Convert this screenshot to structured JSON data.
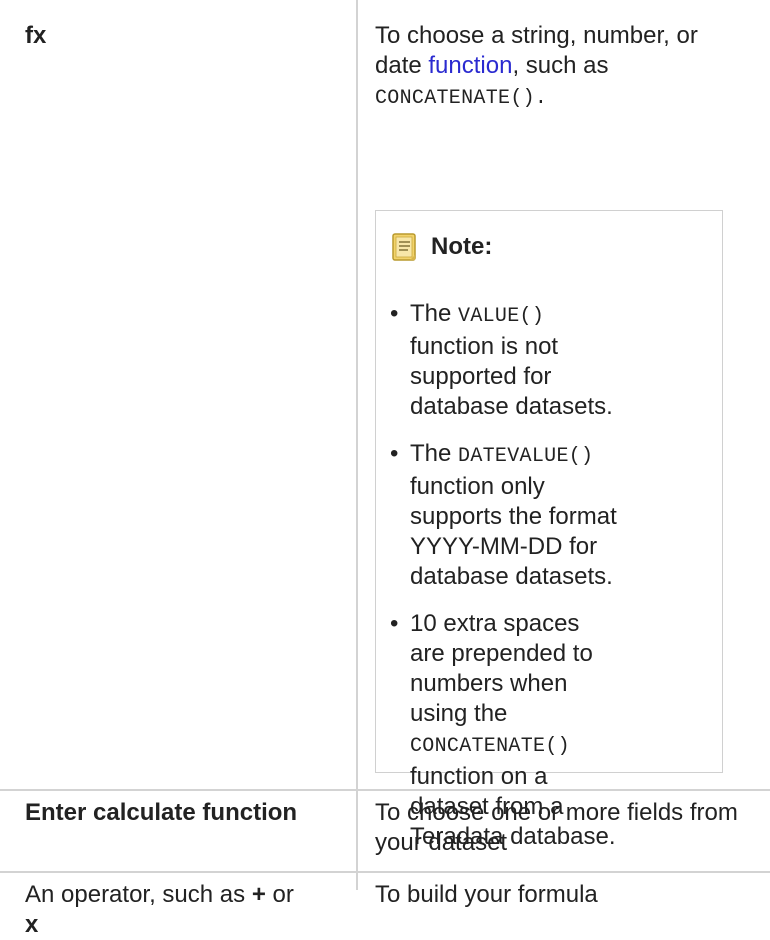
{
  "rows": [
    {
      "left_label": "fx",
      "right": {
        "text_prefix": "To choose a string, number, or date ",
        "link_text": "function",
        "text_middle": ", such as",
        "code": "CONCATENATE().",
        "note": {
          "title": "Note:",
          "items": [
            {
              "prefix": "The ",
              "code": "VALUE()",
              "suffix": " function is not supported for database datasets."
            },
            {
              "prefix": "The ",
              "code": "DATEVALUE()",
              "suffix": " function only supports the format YYYY-MM-DD for database datasets."
            },
            {
              "prefix": "10 extra spaces are prepended to numbers when using the ",
              "code": "CONCATENATE()",
              "suffix": " function on a dataset from a Teradata database."
            }
          ]
        }
      }
    },
    {
      "left_label": "Enter calculate function",
      "right_text": "To choose one or more fields from your dataset"
    },
    {
      "left_prefix": "An operator, such as ",
      "left_plus": "+",
      "left_or": " or",
      "left_x": "x",
      "right_text": "To build your formula"
    }
  ],
  "icons": {
    "note": "note-icon",
    "note_color": "#f2d36b"
  }
}
